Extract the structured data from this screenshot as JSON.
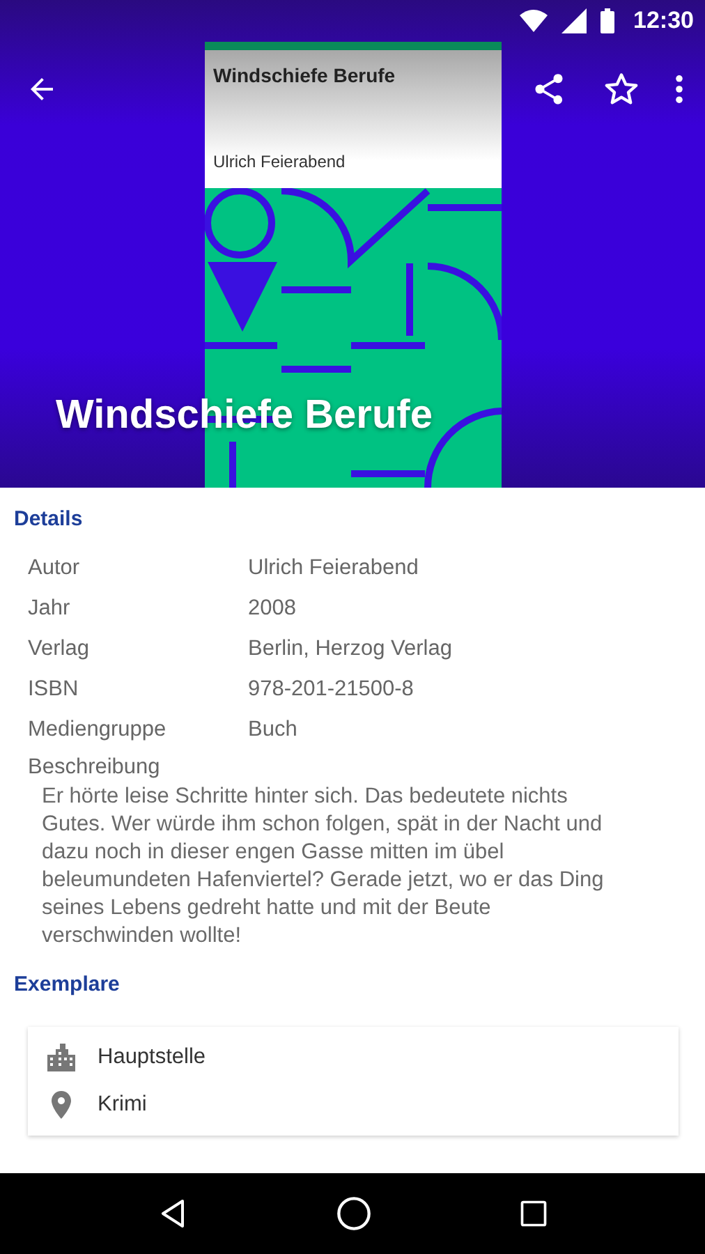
{
  "status_bar": {
    "time": "12:30"
  },
  "header": {
    "title": "Windschiefe Berufe",
    "cover": {
      "title": "Windschiefe Berufe",
      "author": "Ulrich Feierabend"
    },
    "starred": false
  },
  "details": {
    "heading": "Details",
    "rows": [
      {
        "label": "Autor",
        "value": "Ulrich Feierabend"
      },
      {
        "label": "Jahr",
        "value": "2008"
      },
      {
        "label": "Verlag",
        "value": "Berlin, Herzog Verlag"
      },
      {
        "label": "ISBN",
        "value": "978-201-21500-8"
      },
      {
        "label": "Mediengruppe",
        "value": "Buch"
      }
    ],
    "description_label": "Beschreibung",
    "description": "Er hörte leise Schritte hinter sich. Das bedeutete nichts Gutes. Wer würde ihm schon folgen, spät in der Nacht und dazu noch in dieser engen Gasse mitten im übel beleumundeten Hafenviertel? Gerade jetzt, wo er das Ding seines Lebens gedreht hatte und mit der Beute verschwinden wollte!"
  },
  "copies": {
    "heading": "Exemplare",
    "items": [
      {
        "kind": "branch",
        "text": "Hauptstelle"
      },
      {
        "kind": "location",
        "text": "Krimi"
      }
    ]
  }
}
